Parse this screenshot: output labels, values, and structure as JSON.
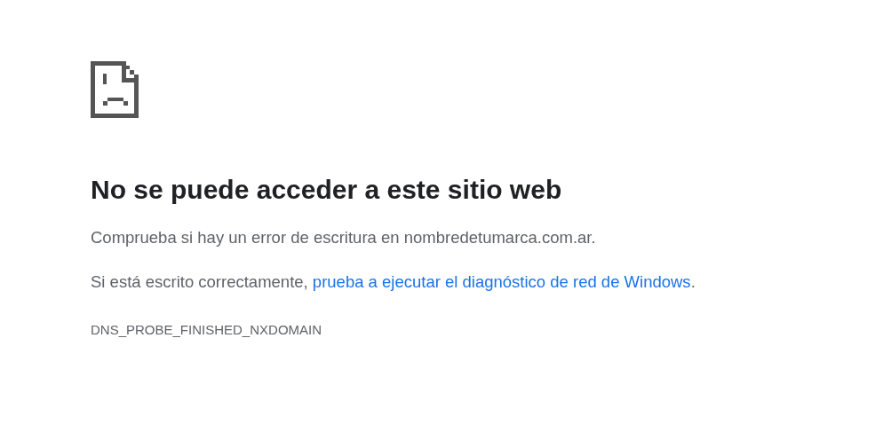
{
  "heading": "No se puede acceder a este sitio web",
  "paragraphs": [
    {
      "text": "Comprueba si hay un error de escritura en nombredetumarca.com.ar."
    },
    {
      "text": "Si está escrito correctamente, ",
      "link": "prueba a ejecutar el diagnóstico de red de Windows",
      "after": "."
    }
  ],
  "error_code": "DNS_PROBE_FINISHED_NXDOMAIN"
}
